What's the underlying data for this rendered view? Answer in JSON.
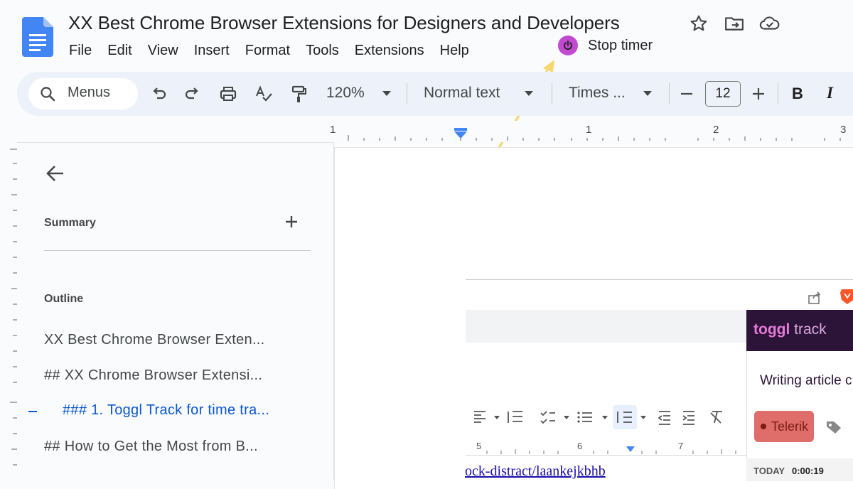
{
  "document": {
    "title": "XX Best Chrome Browser Extensions for Designers and Developers"
  },
  "menu": {
    "items": [
      "File",
      "Edit",
      "View",
      "Insert",
      "Format",
      "Tools",
      "Extensions",
      "Help"
    ]
  },
  "timer": {
    "label": "Stop timer",
    "color": "#c14ad1"
  },
  "toolbar": {
    "search_label": "Menus",
    "zoom": "120%",
    "style": "Normal text",
    "font": "Times ...",
    "font_size": "12",
    "bold": "B",
    "italic": "I"
  },
  "ruler": {
    "labels": [
      "1",
      "1",
      "2",
      "3"
    ]
  },
  "sidepanel": {
    "summary_label": "Summary",
    "outline_label": "Outline",
    "outline_items": [
      {
        "text": "XX Best Chrome Browser Exten...",
        "active": false
      },
      {
        "text": "## XX Chrome Browser Extensi...",
        "active": false
      },
      {
        "text": "### 1. Toggl Track for time tra...",
        "active": true
      },
      {
        "text": "## How to Get the Most from B...",
        "active": false
      }
    ]
  },
  "embedded_screenshot": {
    "link_text": "ock-distract/laankejkbhb",
    "ruler_labels": [
      "5",
      "6",
      "7"
    ],
    "toggl": {
      "logo_bold": "toggl",
      "logo_light": " track",
      "description": "Writing article c",
      "tag": "Telerik",
      "today_label": "TODAY",
      "today_time": "0:00:19"
    }
  },
  "colors": {
    "accent_blue": "#0b57d0",
    "toolbar_bg": "#edf2fa",
    "annotation_arrow": "#f5d76e",
    "toggl_header": "#2c1338"
  }
}
